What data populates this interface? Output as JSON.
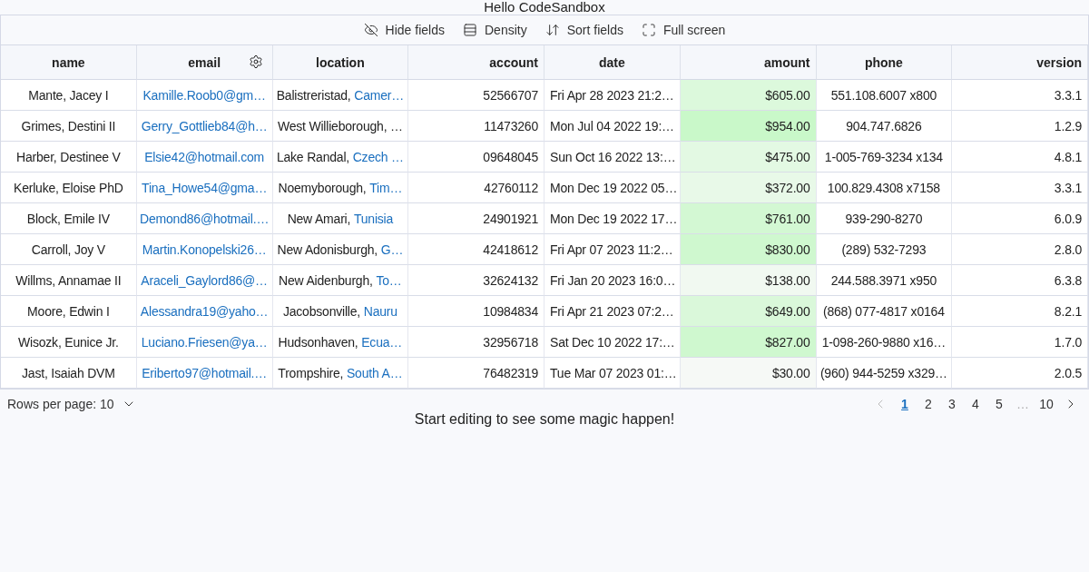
{
  "title": "Hello CodeSandbox",
  "toolbar": [
    {
      "kind": "hide",
      "label": "Hide fields"
    },
    {
      "kind": "density",
      "label": "Density"
    },
    {
      "kind": "sort",
      "label": "Sort fields"
    },
    {
      "kind": "fullscreen",
      "label": "Full screen"
    }
  ],
  "table": {
    "columns": [
      "name",
      "email",
      "location",
      "account",
      "date",
      "amount",
      "phone",
      "version"
    ],
    "rows": [
      {
        "name": "Mante, Jacey I",
        "email": "Kamille.Roob0@gm…",
        "city": "Balistreristad, ",
        "country": "Camer…",
        "account": "52566707",
        "date": "Fri Apr 28 2023 21:2…",
        "amount": "$605.00",
        "color": "#dcf9dc",
        "phone": "551.108.6007 x800",
        "version": "3.3.1"
      },
      {
        "name": "Grimes, Destini II",
        "email": "Gerry_Gottlieb84@h…",
        "city": "West Willieborough, …",
        "account": "11473260",
        "date": "Mon Jul 04 2022 19:…",
        "amount": "$954.00",
        "color": "#c9f8c9",
        "phone": "904.747.6826",
        "version": "1.2.9"
      },
      {
        "name": "Harber, Destinee V",
        "email": "Elsie42@hotmail.com",
        "city": "Lake Randal, ",
        "country": "Czech …",
        "account": "09648045",
        "date": "Sun Oct 16 2022 13:…",
        "amount": "$475.00",
        "color": "#e3f9e3",
        "phone": "1-005-769-3234 x134",
        "version": "4.8.1"
      },
      {
        "name": "Kerluke, Eloise PhD",
        "email": "Tina_Howe54@gma…",
        "city": "Noemyborough, ",
        "country": "Tim…",
        "account": "42760112",
        "date": "Mon Dec 19 2022 05…",
        "amount": "$372.00",
        "color": "#e8f9e8",
        "phone": "100.829.4308 x7158",
        "version": "3.3.1"
      },
      {
        "name": "Block, Emile IV",
        "email": "Demond86@hotmail.…",
        "city": "New Amari, ",
        "country": "Tunisia",
        "account": "24901921",
        "date": "Mon Dec 19 2022 17…",
        "amount": "$761.00",
        "color": "#d3f8d3",
        "phone": "939-290-8270",
        "version": "6.0.9"
      },
      {
        "name": "Carroll, Joy V",
        "email": "Martin.Konopelski26…",
        "city": "New Adonisburgh, ",
        "country": "G…",
        "account": "42418612",
        "date": "Fri Apr 07 2023 11:2…",
        "amount": "$830.00",
        "color": "#cff8cf",
        "phone": "(289) 532-7293",
        "version": "2.8.0"
      },
      {
        "name": "Willms, Annamae II",
        "email": "Araceli_Gaylord86@…",
        "city": "New Aidenburgh, ",
        "country": "To…",
        "account": "32624132",
        "date": "Fri Jan 20 2023 16:0…",
        "amount": "$138.00",
        "color": "#f1f9f1",
        "phone": "244.588.3971 x950",
        "version": "6.3.8"
      },
      {
        "name": "Moore, Edwin I",
        "email": "Alessandra19@yaho…",
        "city": "Jacobsonville, ",
        "country": "Nauru",
        "account": "10984834",
        "date": "Fri Apr 21 2023 07:2…",
        "amount": "$649.00",
        "color": "#daf8da",
        "phone": "(868) 077-4817 x0164",
        "version": "8.2.1"
      },
      {
        "name": "Wisozk, Eunice Jr.",
        "email": "Luciano.Friesen@ya…",
        "city": "Hudsonhaven, ",
        "country": "Ecua…",
        "account": "32956718",
        "date": "Sat Dec 10 2022 17:…",
        "amount": "$827.00",
        "color": "#cff8cf",
        "phone": "1-098-260-9880 x16…",
        "version": "1.7.0"
      },
      {
        "name": "Jast, Isaiah DVM",
        "email": "Eriberto97@hotmail.…",
        "city": "Trompshire, ",
        "country": "South A…",
        "account": "76482319",
        "date": "Tue Mar 07 2023 01:…",
        "amount": "$30.00",
        "color": "#f6f9f6",
        "phone": "(960) 944-5259 x329…",
        "version": "2.0.5"
      }
    ]
  },
  "rows_per_page": "Rows per page: 10",
  "pagination": {
    "prev_disabled": true,
    "pages": [
      {
        "label": "1",
        "selected": true
      },
      {
        "label": "2",
        "selected": false
      },
      {
        "label": "3",
        "selected": false
      },
      {
        "label": "4",
        "selected": false
      },
      {
        "label": "5",
        "selected": false
      },
      {
        "label": "…",
        "kind": "ellipsis",
        "selected": false
      },
      {
        "label": "10",
        "selected": false
      }
    ]
  },
  "message": "Start editing to see some magic happen!"
}
